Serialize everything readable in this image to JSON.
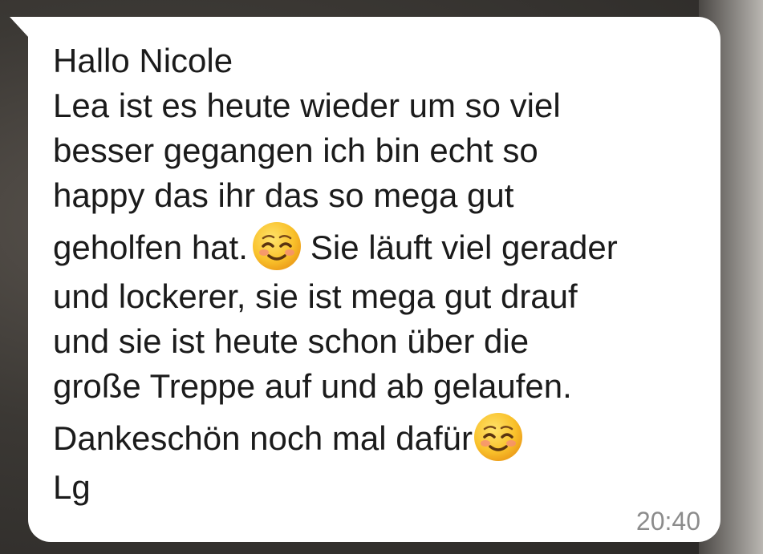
{
  "message": {
    "lines": [
      "Hallo Nicole",
      "Lea ist es heute wieder um so viel",
      "besser gegangen ich bin echt so",
      "happy das ihr das so mega gut",
      "geholfen hat.",
      "Sie läuft viel gerader",
      "und lockerer, sie ist mega gut drauf",
      "und sie ist heute schon über die",
      "große Treppe auf und ab gelaufen.",
      "Dankeschön noch mal dafür",
      "Lg"
    ],
    "timestamp": "20:40",
    "emoji": "smiling-face-with-smiling-eyes-icon",
    "bubble_color": "#ffffff",
    "text_color": "#1b1b1b",
    "time_color": "#8c8c8c"
  }
}
